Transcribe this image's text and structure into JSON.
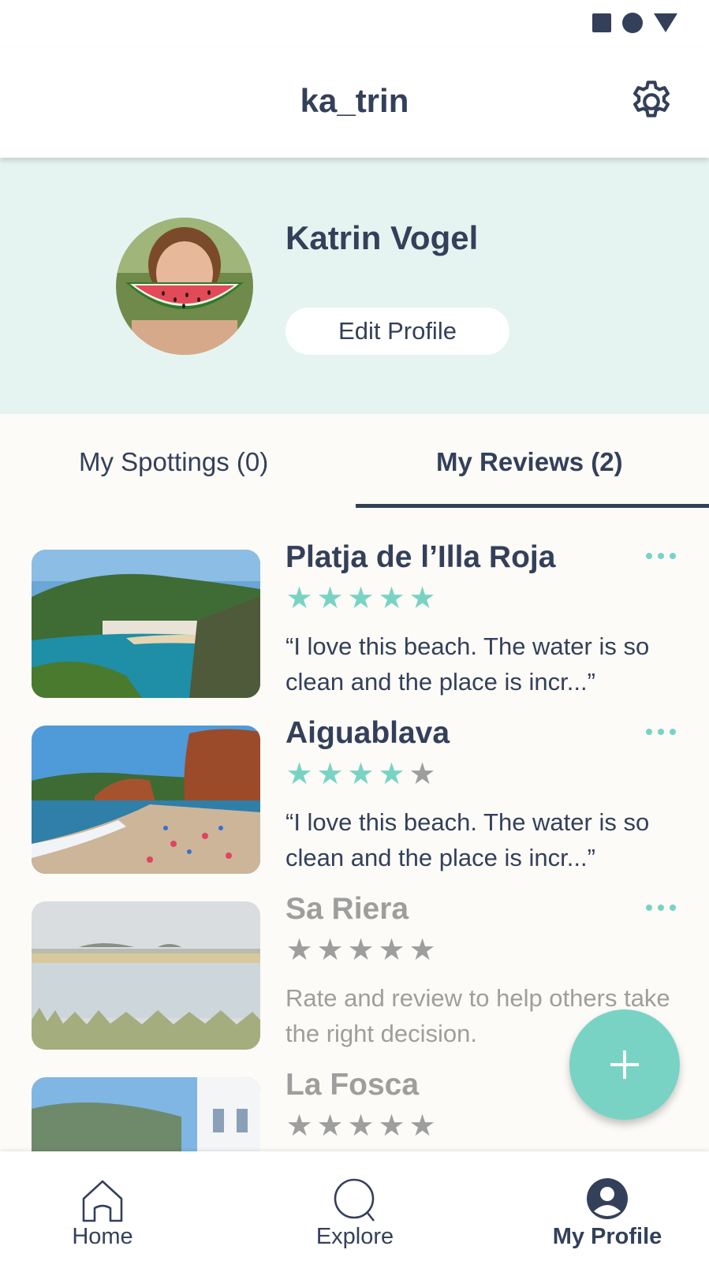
{
  "app_bar": {
    "title": "ka_trin",
    "settings_icon": "gear-icon"
  },
  "profile": {
    "name": "Katrin Vogel",
    "edit_label": "Edit Profile"
  },
  "tabs": [
    {
      "label": "My Spottings (0)",
      "selected": false
    },
    {
      "label": "My Reviews (2)",
      "selected": true
    }
  ],
  "reviews": [
    {
      "title": "Platja de l’Illa Roja",
      "rating": 5,
      "text": "“I love this beach. The water is so clean and the place is incr...”",
      "reviewed": true
    },
    {
      "title": "Aiguablava",
      "rating": 4,
      "text": "“I love this beach. The water is so clean and the place is incr...”",
      "reviewed": true
    },
    {
      "title": "Sa Riera",
      "rating": 0,
      "text": "Rate and review to help others take the right decision.",
      "reviewed": false
    },
    {
      "title": "La Fosca",
      "rating": 0,
      "text": "",
      "reviewed": false
    }
  ],
  "fab": {
    "icon": "plus-icon"
  },
  "bottom_nav": [
    {
      "label": "Home",
      "icon": "home-icon",
      "active": false
    },
    {
      "label": "Explore",
      "icon": "search-icon",
      "active": false
    },
    {
      "label": "My Profile",
      "icon": "profile-icon",
      "active": true
    }
  ],
  "colors": {
    "primary_text": "#34405a",
    "accent": "#79d3c4",
    "header_bg": "#e6f4f1",
    "muted": "#9e9e9e",
    "page_bg": "#fcfbf7"
  }
}
